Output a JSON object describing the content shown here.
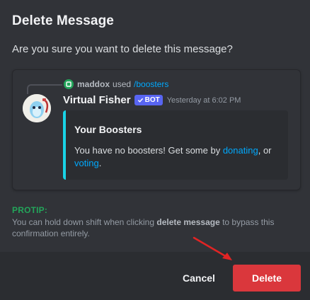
{
  "dialog": {
    "title": "Delete Message",
    "question": "Are you sure you want to delete this message?"
  },
  "message": {
    "reply": {
      "user": "maddox",
      "used": "used",
      "command": "/boosters"
    },
    "author": "Virtual Fisher",
    "badge": "BOT",
    "timestamp": "Yesterday at 6:02 PM",
    "avatar_icon": "fisher-avatar-icon",
    "embed": {
      "accent_color": "#19d3e6",
      "title": "Your Boosters",
      "desc_before": "You have no boosters! Get some by ",
      "link1": "donating",
      "desc_middle": ", or",
      "link2": "voting",
      "desc_after": "."
    }
  },
  "protip": {
    "label": "PROTIP:",
    "text_before": "You can hold down shift when clicking ",
    "text_bold": "delete message",
    "text_after": " to bypass this confirmation entirely."
  },
  "footer": {
    "cancel_label": "Cancel",
    "delete_label": "Delete"
  },
  "colors": {
    "background": "#313338",
    "footer": "#2b2d31",
    "danger": "#da373c",
    "link": "#00a8fc",
    "protip": "#23a55a",
    "annotation_arrow": "#e02424"
  }
}
